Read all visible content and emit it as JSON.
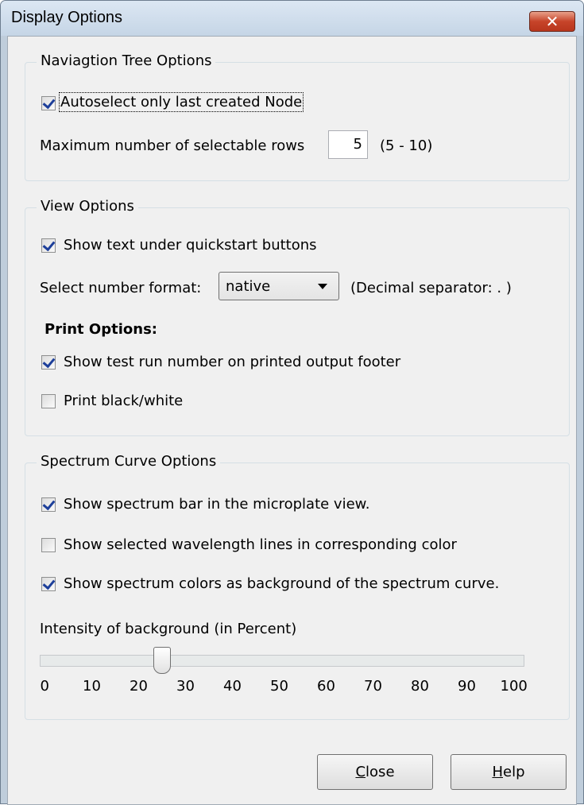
{
  "window": {
    "title": "Display Options",
    "close_glyph": "✕"
  },
  "navigation_tree": {
    "title": "Naviagtion Tree Options",
    "autoselect_label": "Autoselect only last created Node",
    "autoselect_checked": true,
    "max_rows_label": "Maximum number of selectable rows",
    "max_rows_value": "5",
    "max_rows_range": "(5 - 10)"
  },
  "view_options": {
    "title": "View Options",
    "show_text_label": "Show text under quickstart buttons",
    "show_text_checked": true,
    "number_format_label": "Select number format:",
    "number_format_value": "native",
    "decimal_separator": "(Decimal separator: . )",
    "print_options_heading": "Print Options:",
    "show_test_run_label": "Show test run number on printed output footer",
    "show_test_run_checked": true,
    "print_bw_label": "Print black/white",
    "print_bw_checked": false
  },
  "spectrum": {
    "title": "Spectrum Curve Options",
    "show_bar_label": "Show spectrum bar in the microplate view.",
    "show_bar_checked": true,
    "show_wavelength_label": "Show selected wavelength lines in corresponding color",
    "show_wavelength_checked": false,
    "show_colors_label": "Show spectrum colors as background of the spectrum curve.",
    "show_colors_checked": true,
    "intensity_label": "Intensity of background (in Percent)",
    "intensity_value": 25,
    "tick_labels": [
      "0",
      "10",
      "20",
      "30",
      "40",
      "50",
      "60",
      "70",
      "80",
      "90",
      "100"
    ]
  },
  "buttons": {
    "close_label_mnemonic": "C",
    "close_label_rest": "lose",
    "help_label_mnemonic": "H",
    "help_label_rest": "elp"
  }
}
